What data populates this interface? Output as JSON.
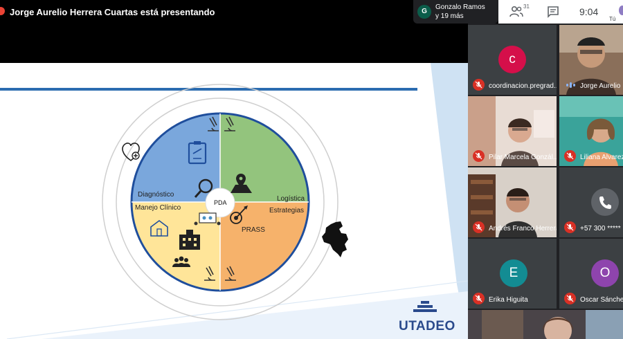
{
  "presenter_bar": {
    "text": "Jorge Aurelio Herrera Cuartas está presentando"
  },
  "participants_chip": {
    "avatar_letter": "G",
    "line1": "Gonzalo Ramos",
    "line2": "y 19 más"
  },
  "controls": {
    "people_count": "31",
    "time": "9:04",
    "self_label": "Tú",
    "icons": [
      "people-icon",
      "chat-icon"
    ]
  },
  "slide": {
    "sections": {
      "diagnostico": "Diagnóstico",
      "logistica": "Logística",
      "manejo_clinico": "Manejo Clínico",
      "estrategias": "Estrategias",
      "prass": "PRASS",
      "center": "PDA"
    },
    "logo": "UTADEO",
    "colors": {
      "diagnostico": "#7aa7dc",
      "logistica": "#93c47d",
      "manejo_clinico": "#ffe599",
      "estrategias": "#f6b26b",
      "circle_border": "#1f4e9c",
      "header_rule": "#2b6cb0"
    },
    "icons": [
      "microscope-icon",
      "clipboard-icon",
      "magnifier-icon",
      "map-pin-icon",
      "heart-plus-icon",
      "house-icon",
      "hospital-icon",
      "people-group-icon",
      "target-icon",
      "colombia-map-icon"
    ]
  },
  "gallery": {
    "tiles": [
      {
        "name": "coordinacion.pregrad...",
        "avatar": "c",
        "avatar_color": "#d50f4a",
        "muted": true
      },
      {
        "name": "Jorge Aurelio",
        "muted": false,
        "speaking": true
      },
      {
        "name": "Pilar Marcela Gonzál...",
        "muted": true
      },
      {
        "name": "Liliana Alvarez",
        "muted": true
      },
      {
        "name": "Andrés Franco Herrera",
        "muted": true
      },
      {
        "name": "+57 300 *****",
        "muted": true
      },
      {
        "name": "Erika Higuita",
        "avatar": "E",
        "avatar_color": "#138c93",
        "muted": true
      },
      {
        "name": "Oscar Sánchez",
        "avatar": "O",
        "avatar_color": "#8e44ad",
        "muted": true
      }
    ]
  }
}
